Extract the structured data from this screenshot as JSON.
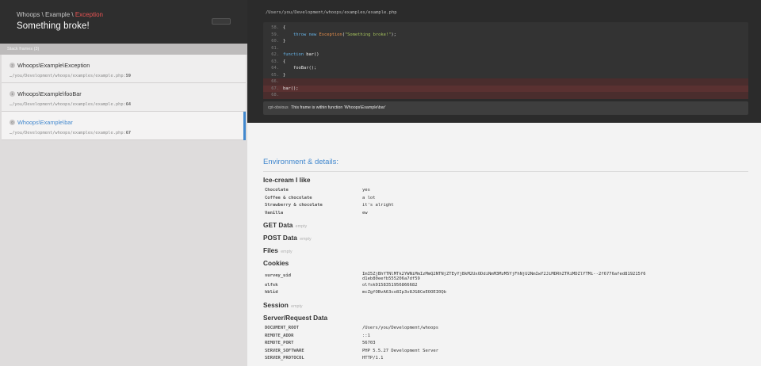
{
  "header": {
    "breadcrumb_1": "Whoops",
    "sep_1": " \\ ",
    "breadcrumb_2": "Example",
    "sep_2": " \\ ",
    "breadcrumb_3": "Exception",
    "title": "Something broke!"
  },
  "frames_label": "Stack frames (3)",
  "frames": [
    {
      "index": "2",
      "name": "Whoops\\Example\\Exception",
      "file": "…/you/Development/whoops/examples/example.php",
      "line": "59"
    },
    {
      "index": "1",
      "name": "Whoops\\Example\\fooBar",
      "file": "…/you/Development/whoops/examples/example.php",
      "line": "64"
    },
    {
      "index": "0",
      "name": "Whoops\\Example\\bar",
      "file": "…/you/Development/whoops/examples/example.php",
      "line": "67"
    }
  ],
  "code": {
    "file_path": "/Users/you/Development/whoops/examples/example.php",
    "lines": [
      {
        "num": "58.",
        "text": "{"
      },
      {
        "num": "59.",
        "text": "    throw new Exception(\"Something broke!\");"
      },
      {
        "num": "60.",
        "text": "}"
      },
      {
        "num": "61.",
        "text": ""
      },
      {
        "num": "62.",
        "text": "function bar()"
      },
      {
        "num": "63.",
        "text": "{"
      },
      {
        "num": "64.",
        "text": "    fooBar();"
      },
      {
        "num": "65.",
        "text": "}"
      },
      {
        "num": "66.",
        "text": ""
      },
      {
        "num": "67.",
        "text": "bar();"
      },
      {
        "num": "68.",
        "text": ""
      }
    ],
    "comment_tag": "cpt-obvious",
    "comment_text": "This frame is within function 'Whoops\\Example\\bar'"
  },
  "details": {
    "heading": "Environment & details:",
    "empty_label": "empty",
    "icecream": {
      "title": "Ice-cream I like",
      "rows": [
        {
          "k": "Chocolate",
          "v": "yes"
        },
        {
          "k": "Coffee & chocolate",
          "v": "a lot"
        },
        {
          "k": "Strawberry & chocolate",
          "v": "it's alright"
        },
        {
          "k": "Vanilla",
          "v": "ew"
        }
      ]
    },
    "get_title": "GET Data",
    "post_title": "POST Data",
    "files_title": "Files",
    "cookies": {
      "title": "Cookies",
      "rows": [
        {
          "k": "survey_uid",
          "v": "ImI5ZjBhYTNlMTk2YWNiMmIzMmQ2NTNjZTEyYjBkM2UxODdiNmM3MzM5YjFhNjU2NmIwY2JiMDRhZTRiMDZlYTMi--2f6776afed819215f6d1eb80eefb555206a7df59"
        },
        {
          "k": "olfsk",
          "v": "olfsk9158351956866682"
        },
        {
          "k": "hblid",
          "v": "mcZgfOBvA63co8Ip3v8JG8CeEOOEI0Qb"
        }
      ]
    },
    "session_title": "Session",
    "server": {
      "title": "Server/Request Data",
      "rows": [
        {
          "k": "DOCUMENT_ROOT",
          "v": "/Users/you/Development/whoops"
        },
        {
          "k": "REMOTE_ADDR",
          "v": "::1"
        },
        {
          "k": "REMOTE_PORT",
          "v": "56703"
        },
        {
          "k": "SERVER_SOFTWARE",
          "v": "PHP 5.5.27 Development Server"
        },
        {
          "k": "SERVER_PROTOCOL",
          "v": "HTTP/1.1"
        }
      ]
    }
  }
}
